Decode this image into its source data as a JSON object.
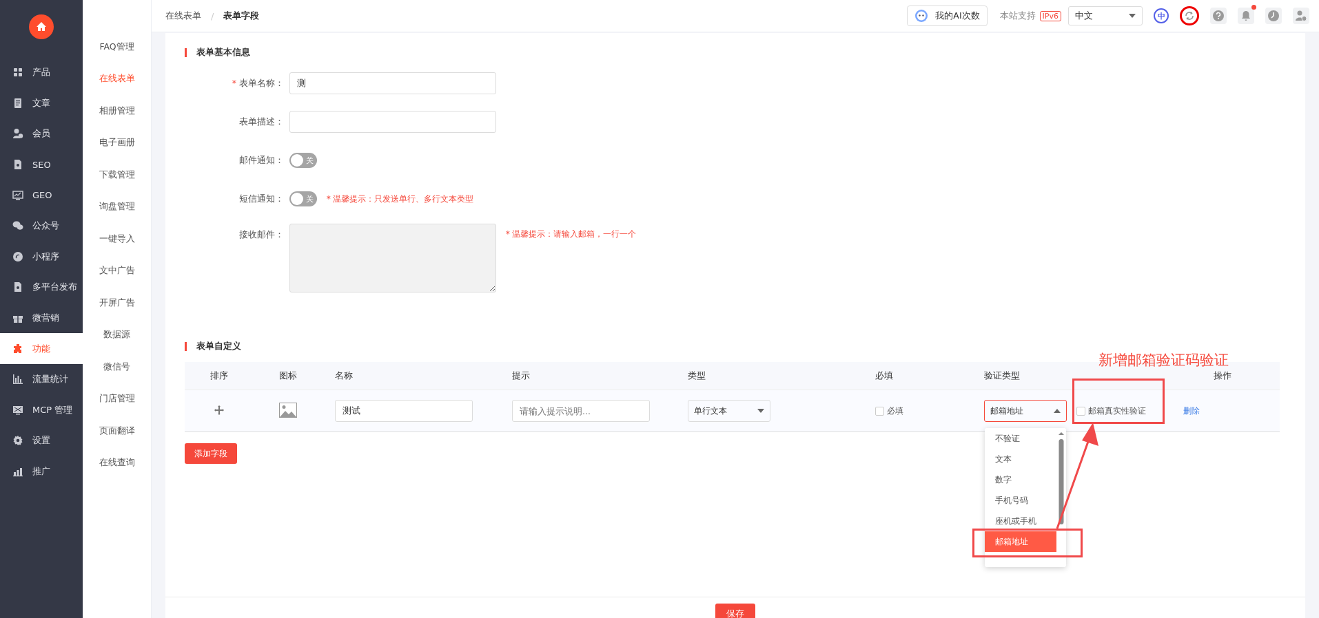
{
  "sidebar": {
    "items": [
      {
        "label": "产品",
        "selected": false
      },
      {
        "label": "文章",
        "selected": false
      },
      {
        "label": "会员",
        "selected": false
      },
      {
        "label": "SEO",
        "selected": false
      },
      {
        "label": "GEO",
        "selected": false
      },
      {
        "label": "公众号",
        "selected": false
      },
      {
        "label": "小程序",
        "selected": false
      },
      {
        "label": "多平台发布",
        "selected": false
      },
      {
        "label": "微营销",
        "selected": false
      },
      {
        "label": "功能",
        "selected": true
      },
      {
        "label": "流量统计",
        "selected": false
      },
      {
        "label": "MCP 管理",
        "selected": false
      },
      {
        "label": "设置",
        "selected": false
      },
      {
        "label": "推广",
        "selected": false
      }
    ]
  },
  "subnav": {
    "items": [
      {
        "label": "FAQ管理",
        "selected": false
      },
      {
        "label": "在线表单",
        "selected": true
      },
      {
        "label": "相册管理",
        "selected": false
      },
      {
        "label": "电子画册",
        "selected": false
      },
      {
        "label": "下载管理",
        "selected": false
      },
      {
        "label": "询盘管理",
        "selected": false
      },
      {
        "label": "一键导入",
        "selected": false
      },
      {
        "label": "文中广告",
        "selected": false
      },
      {
        "label": "开屏广告",
        "selected": false
      },
      {
        "label": "数据源",
        "selected": false
      },
      {
        "label": "微信号",
        "selected": false
      },
      {
        "label": "门店管理",
        "selected": false
      },
      {
        "label": "页面翻译",
        "selected": false
      },
      {
        "label": "在线查询",
        "selected": false
      }
    ]
  },
  "topbar": {
    "breadcrumb": [
      "在线表单",
      "表单字段"
    ],
    "breadcrumb_separator": "/",
    "ai_button": "我的AI次数",
    "ipv6_label": "本站支持",
    "ipv6_badge": "IPv6",
    "language": "中文",
    "language_icon": "中",
    "refresh_highlighted": true,
    "has_unread_notifications": true
  },
  "basic_info": {
    "title": "表单基本信息",
    "required_mark": "*",
    "fields": [
      {
        "kind": "text",
        "label": "表单名称：",
        "required": true,
        "value": "测"
      },
      {
        "kind": "text",
        "label": "表单描述：",
        "required": false
      },
      {
        "kind": "switch",
        "label": "邮件通知：",
        "required": false,
        "on": false,
        "switch_text": "关"
      },
      {
        "kind": "switch",
        "label": "短信通知：",
        "required": false,
        "on": false,
        "switch_text": "关",
        "hint": "* 温馨提示：只发送单行、多行文本类型"
      },
      {
        "kind": "textarea",
        "label": "接收邮件：",
        "required": false,
        "disabled": true,
        "hint": "* 温馨提示：请输入邮箱，一行一个"
      }
    ]
  },
  "custom_fields": {
    "title": "表单自定义",
    "columns": [
      "排序",
      "图标",
      "名称",
      "提示",
      "类型",
      "必填",
      "验证类型",
      "操作"
    ],
    "rows": [
      {
        "name": "测试",
        "hint_placeholder": "请输入提示说明...",
        "type": "单行文本",
        "required_label": "必填",
        "required": false,
        "validation": "邮箱地址",
        "email_verify_label": "邮箱真实性验证",
        "email_verify": false,
        "action": "删除"
      }
    ],
    "validation_options": [
      {
        "label": "不验证",
        "selected": false
      },
      {
        "label": "文本",
        "selected": false
      },
      {
        "label": "数字",
        "selected": false
      },
      {
        "label": "手机号码",
        "selected": false
      },
      {
        "label": "座机或手机",
        "selected": false
      },
      {
        "label": "邮箱地址",
        "selected": true
      }
    ],
    "add_button": "添加字段"
  },
  "save_button": "保存",
  "annotation": {
    "text": "新增邮箱验证码验证"
  }
}
